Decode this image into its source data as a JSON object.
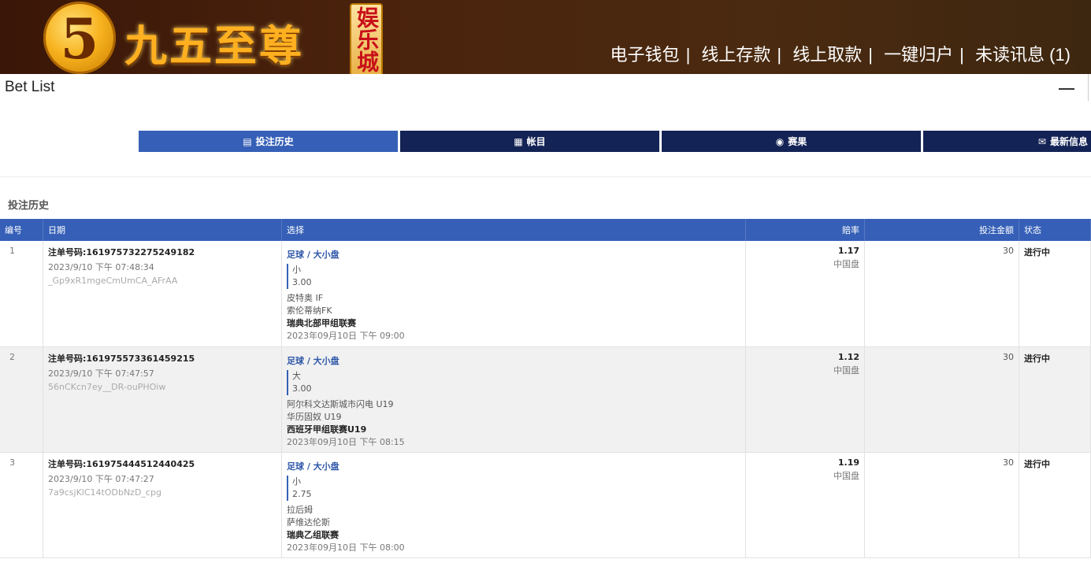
{
  "header": {
    "logo_mark": "5",
    "logo_text": "九五至尊",
    "logo_badge": "娱乐城",
    "nav": [
      "电子钱包",
      "线上存款",
      "线上取款",
      "一键归户",
      "未读讯息 (1)"
    ]
  },
  "panel": {
    "title": "Bet List"
  },
  "tabs": [
    {
      "label": "投注历史",
      "icon": "receipt-icon",
      "active": true
    },
    {
      "label": "帐目",
      "icon": "ledger-icon",
      "active": false
    },
    {
      "label": "赛果",
      "icon": "trophy-icon",
      "active": false
    },
    {
      "label": "最新信息",
      "icon": "mail-icon",
      "active": false
    }
  ],
  "section_title": "投注历史",
  "table": {
    "headers": [
      "编号",
      "日期",
      "选择",
      "赔率",
      "投注金额",
      "状态"
    ],
    "rows": [
      {
        "no": "1",
        "ticket": "注单号码:161975732275249182",
        "date": "2023/9/10 下午 07:48:34",
        "code": "_Gp9xR1mgeCmUmCA_AFrAA",
        "sport": "足球 / 大小盘",
        "pick": "小",
        "line": "3.00",
        "home": "皮特奥 IF",
        "away": "索伦蒂纳FK",
        "league": "瑞典北部甲组联赛",
        "kickoff": "2023年09月10日 下午 09:00",
        "odds": "1.17",
        "odds_type": "中国盘",
        "amount": "30",
        "status": "进行中"
      },
      {
        "no": "2",
        "ticket": "注单号码:161975573361459215",
        "date": "2023/9/10 下午 07:47:57",
        "code": "56nCKcn7ey__DR-ouPHOiw",
        "sport": "足球 / 大小盘",
        "pick": "大",
        "line": "3.00",
        "home": "阿尔科文达斯城市闪电 U19",
        "away": "华历固奴 U19",
        "league": "西班牙甲组联赛U19",
        "kickoff": "2023年09月10日 下午 08:15",
        "odds": "1.12",
        "odds_type": "中国盘",
        "amount": "30",
        "status": "进行中"
      },
      {
        "no": "3",
        "ticket": "注单号码:161975444512440425",
        "date": "2023/9/10 下午 07:47:27",
        "code": "7a9csjKlC14tODbNzD_cpg",
        "sport": "足球 / 大小盘",
        "pick": "小",
        "line": "2.75",
        "home": "拉后姆",
        "away": "萨维达伦斯",
        "league": "瑞典乙组联赛",
        "kickoff": "2023年09月10日 下午 08:00",
        "odds": "1.19",
        "odds_type": "中国盘",
        "amount": "30",
        "status": "进行中"
      }
    ]
  }
}
